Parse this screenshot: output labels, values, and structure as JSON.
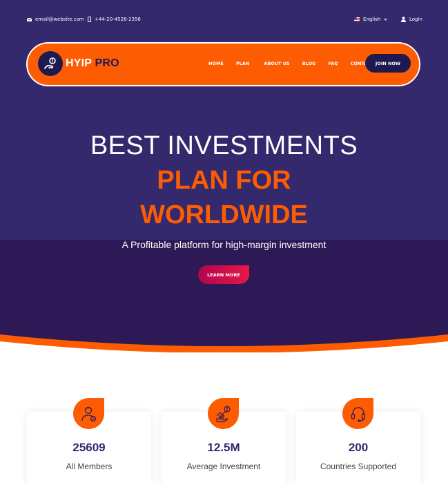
{
  "topbar": {
    "email": "email@website.com",
    "phone": "+44-20-4526-2356",
    "language": "English",
    "login": "Login"
  },
  "brand": {
    "name_part1": "HYIP",
    "name_part2": "PRO"
  },
  "nav": {
    "items": [
      "HOME",
      "PLAN",
      "ABOUT US",
      "BLOG",
      "FAQ",
      "CONTACT"
    ],
    "cta": "JOIN NOW"
  },
  "hero": {
    "line1": "BEST INVESTMENTS",
    "line2": "PLAN FOR",
    "line3": "WORLDWIDE",
    "subtitle": "A Profitable platform for high-margin investment",
    "button": "LEARN MORE"
  },
  "stats": [
    {
      "value": "25609",
      "label": "All Members",
      "icon": "member-icon"
    },
    {
      "value": "12.5M",
      "label": "Average Investment",
      "icon": "investment-icon"
    },
    {
      "value": "200",
      "label": "Countries Supported",
      "icon": "headset-icon"
    }
  ],
  "colors": {
    "primary": "#fd5c03",
    "hero_bg": "#33296c",
    "hero_bg_lower": "#2d1955",
    "dark_navy": "#1d1a52",
    "accent_red": "#e81747"
  }
}
